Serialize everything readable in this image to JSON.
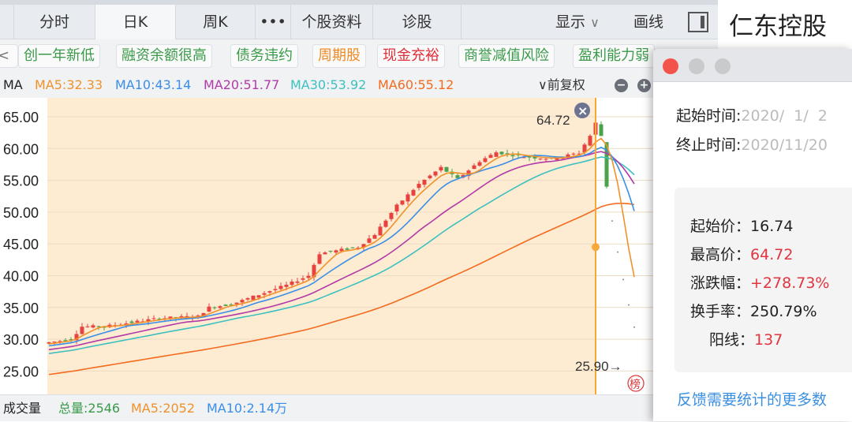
{
  "tabs": {
    "items": [
      "分时",
      "日K",
      "周K",
      "•••",
      "个股资料",
      "诊股"
    ],
    "selected": "日K",
    "display_label": "显示",
    "display_chevron": "∨",
    "draw_label": "画线"
  },
  "stock": {
    "name": "仁东控股"
  },
  "tags": [
    {
      "label": "创一年新低",
      "color": "#3a9a4a"
    },
    {
      "label": "融资余额很高",
      "color": "#3a9a4a"
    },
    {
      "label": "债务违约",
      "color": "#3a9a4a"
    },
    {
      "label": "周期股",
      "color": "#f08a24"
    },
    {
      "label": "现金充裕",
      "color": "#e0303a"
    },
    {
      "label": "商誉减值风险",
      "color": "#3a9a4a"
    },
    {
      "label": "盈利能力弱",
      "color": "#3a9a4a"
    }
  ],
  "tag_scroll_left": "<",
  "ma": {
    "label": "MA",
    "ma5": "MA5:32.33",
    "ma10": "MA10:43.14",
    "ma20": "MA20:51.77",
    "ma30": "MA30:53.92",
    "ma60": "MA60:55.12",
    "adjust": "∨前复权",
    "minus": "−",
    "plus": "+"
  },
  "colors": {
    "ma5": "#f0922a",
    "ma10": "#3a8ee6",
    "ma20": "#b23aa8",
    "ma30": "#3cc1c0",
    "ma60": "#f36b1f",
    "up": "#e8423f",
    "down": "#4aa24a",
    "highlight_bg": "#fdebd2"
  },
  "chart_data": {
    "type": "candlestick",
    "yticks": [
      "65.00",
      "60.00",
      "55.00",
      "50.00",
      "45.00",
      "40.00",
      "35.00",
      "30.00",
      "25.00"
    ],
    "ylim": [
      21,
      67
    ],
    "anchor_days": [
      0,
      4,
      6,
      10,
      20,
      27,
      29,
      33,
      38,
      43,
      47,
      49,
      56,
      59,
      63,
      67,
      71,
      74,
      78,
      81,
      86,
      91,
      96,
      98,
      99,
      100,
      101
    ],
    "anchor_closes": [
      29.5,
      30,
      32,
      32,
      33.3,
      33.6,
      35,
      35.5,
      37,
      38.5,
      40,
      43.5,
      44.5,
      46.5,
      51,
      54.4,
      57,
      55.2,
      58,
      59.4,
      58.7,
      58.4,
      59.3,
      62,
      64,
      62,
      54
    ],
    "tail_closes": [
      48.6,
      43.7,
      39.4,
      35.4,
      31.9
    ],
    "high_label": "64.72",
    "low_label": "25.90→",
    "close_icon": "×",
    "rank_badge": "榜"
  },
  "volume": {
    "label": "成交量",
    "total": "总量:2546",
    "ma5": "MA5:2052",
    "ma10": "MA10:2.14万"
  },
  "popup": {
    "start_label": "起始时间:",
    "start_value": "2020/  1/  2",
    "end_label": "终止时间:",
    "end_value": "2020/11/20",
    "stats": [
      {
        "label": "起始价：",
        "value": "16.74",
        "red": false
      },
      {
        "label": "最高价：",
        "value": "64.72",
        "red": true
      },
      {
        "label": "涨跌幅：",
        "value": "+278.73%",
        "red": true
      },
      {
        "label": "换手率：",
        "value": "250.79%",
        "red": false
      },
      {
        "label": "阳线：",
        "value": "137",
        "red": true
      }
    ],
    "feedback_link": "反馈需要统计的更多数"
  }
}
